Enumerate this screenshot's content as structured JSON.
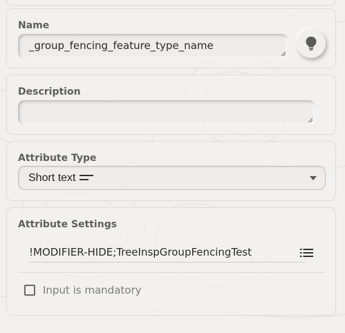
{
  "name_section": {
    "label": "Name",
    "value": "_group_fencing_feature_type_name",
    "suggest_icon": "lightbulb-icon"
  },
  "description_section": {
    "label": "Description",
    "value": ""
  },
  "attribute_type_section": {
    "label": "Attribute Type",
    "selected": "Short text",
    "type_icon": "short-text-icon",
    "dropdown_icon": "caret-down-icon"
  },
  "attribute_settings_section": {
    "label": "Attribute Settings",
    "value": "!MODIFIER-HIDE;TreeInspGroupFencingTest",
    "list_icon": "list-icon",
    "mandatory_label": "Input is mandatory",
    "mandatory_checked": false
  },
  "colors": {
    "background": "#f2f0ee",
    "label": "#5e5e5e",
    "field": "#efecea",
    "card_border": "#dedad7"
  }
}
